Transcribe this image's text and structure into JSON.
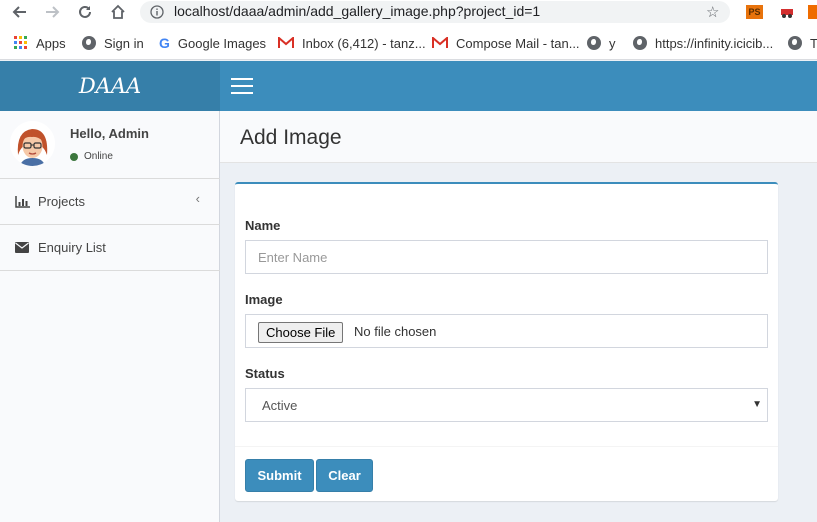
{
  "browser": {
    "url": "localhost/daaa/admin/add_gallery_image.php?project_id=1",
    "extensions": [
      {
        "name": "ps-extension-icon",
        "label": "PS",
        "color": "#e8730c"
      },
      {
        "name": "red-extension-icon",
        "label": "",
        "color": "#d32f2f"
      },
      {
        "name": "orange-extension-icon",
        "label": "",
        "color": "#ef6c00"
      }
    ]
  },
  "bookmarks": [
    {
      "label": "Apps",
      "icon": "apps-grid-icon"
    },
    {
      "label": "Sign in",
      "icon": "globe-icon"
    },
    {
      "label": "Google Images",
      "icon": "google-icon"
    },
    {
      "label": "Inbox (6,412) - tanz...",
      "icon": "gmail-icon"
    },
    {
      "label": "Compose Mail - tan...",
      "icon": "gmail-icon"
    },
    {
      "label": "y",
      "icon": "globe-icon"
    },
    {
      "label": "https://infinity.icicib...",
      "icon": "globe-icon"
    },
    {
      "label": "T",
      "icon": "globe-icon"
    }
  ],
  "app": {
    "logo": "DAAA",
    "brand_color": "#3c8dbc"
  },
  "user": {
    "greeting": "Hello, Admin",
    "status": "Online",
    "status_color": "#3c763d"
  },
  "sidebar": {
    "items": [
      {
        "label": "Projects",
        "icon": "bar-chart-icon",
        "has_submenu": true
      },
      {
        "label": "Enquiry List",
        "icon": "envelope-icon",
        "has_submenu": false
      }
    ]
  },
  "page": {
    "title": "Add Image"
  },
  "form": {
    "name_label": "Name",
    "name_placeholder": "Enter Name",
    "name_value": "",
    "image_label": "Image",
    "choose_file_label": "Choose File",
    "no_file_text": "No file chosen",
    "status_label": "Status",
    "status_value": "Active",
    "submit_label": "Submit",
    "clear_label": "Clear"
  }
}
